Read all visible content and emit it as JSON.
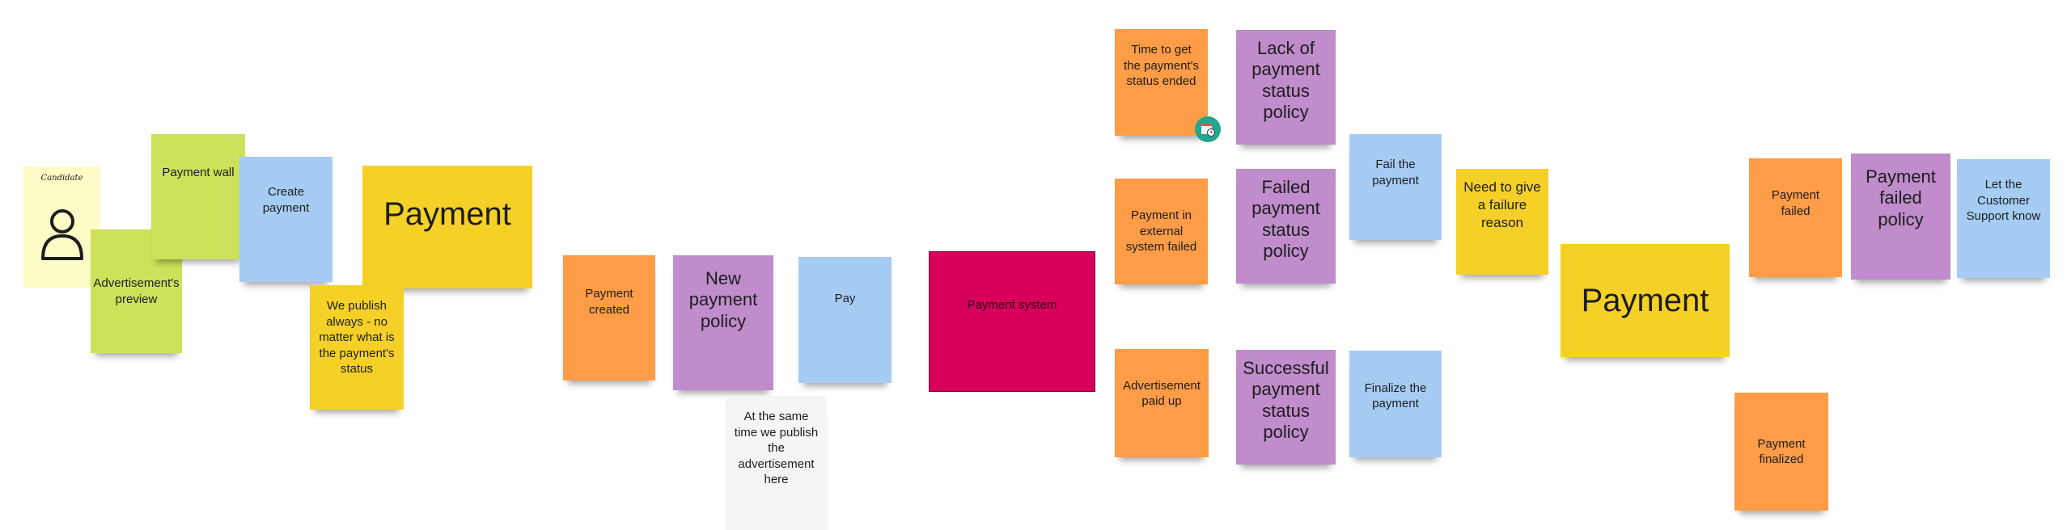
{
  "notes": {
    "candidate": "Candidate",
    "advert_preview": "Advertisement's preview",
    "payment_wall": "Payment wall",
    "create_payment": "Create payment",
    "payment_aggregate_1": "Payment",
    "we_publish": "We publish always - no matter what is the payment's status",
    "payment_created": "Payment created",
    "new_payment_policy": "New payment policy",
    "pay": "Pay",
    "at_same_time": "At the same time we publish the advertisement here",
    "payment_system": "Payment system",
    "time_to_get": "Time to get the payment's status ended",
    "lack_policy": "Lack of payment status policy",
    "external_failed": "Payment  in external system failed",
    "failed_status_policy": "Failed payment status policy",
    "fail_payment": "Fail the payment",
    "need_reason": "Need to give a failure reason",
    "advert_paid": "Advertisement paid up",
    "successful_policy": "Successful payment status policy",
    "finalize_payment": "Finalize the payment",
    "payment_aggregate_2": "Payment",
    "payment_failed": "Payment failed",
    "payment_failed_policy": "Payment failed policy",
    "let_support_know": "Let the Customer Support know",
    "payment_finalized": "Payment finalized"
  },
  "colors": {
    "event": "#fe9c47",
    "policy": "#c08ccb",
    "command": "#a6ccf4",
    "aggregate": "#f5d128",
    "read_model": "#cde15a",
    "actor": "#fdfcc6",
    "external_system": "#d8005c",
    "comment": "#f4f5f7"
  },
  "icons": {
    "actor": "user-icon",
    "timer": "calendar-clock-icon"
  }
}
